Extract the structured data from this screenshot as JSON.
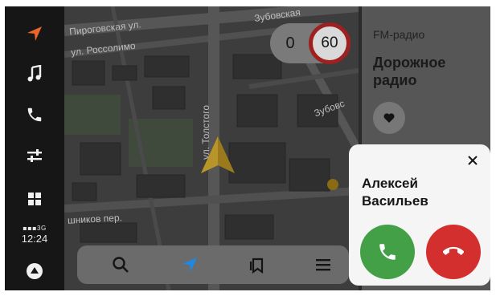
{
  "sidebar": {
    "icons": [
      "navigation-icon",
      "music-icon",
      "phone-icon",
      "settings-sliders-icon",
      "apps-grid-icon",
      "alice-icon"
    ],
    "network": "3G",
    "time": "12:24"
  },
  "map": {
    "streets": [
      "Пироговская ул.",
      "ул. Россолимо",
      "Зубовская",
      "Зубовс",
      "ул. Толстого",
      "шников пер."
    ],
    "speed": {
      "current": "0",
      "limit": "60"
    }
  },
  "toolbar": {
    "icons": [
      "search-icon",
      "navigation-arrow-icon",
      "bookmarks-icon",
      "menu-icon"
    ]
  },
  "radio": {
    "label": "FM-радио",
    "station": "Дорожное радио"
  },
  "call": {
    "caller_name": "Алексей Васильев"
  },
  "colors": {
    "accent_orange": "#e8662c",
    "nav_arrow_blue": "#1e88e5",
    "accept_green": "#43a047",
    "decline_red": "#d32f2f",
    "speed_limit_ring": "#9e2020"
  }
}
